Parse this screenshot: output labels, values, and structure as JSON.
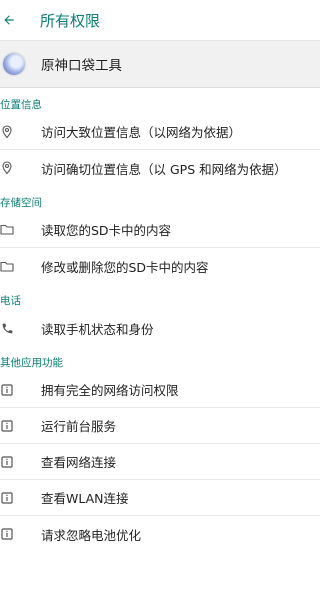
{
  "header": {
    "title": "所有权限",
    "back_icon": "arrow-back-icon"
  },
  "app": {
    "name": "原神口袋工具",
    "icon": "app-icon"
  },
  "sections": [
    {
      "title": "位置信息",
      "items": [
        {
          "label": "访问大致位置信息（以网络为依据）",
          "icon": "location-pin-icon"
        },
        {
          "label": "访问确切位置信息（以 GPS 和网络为依据）",
          "icon": "location-pin-icon"
        }
      ]
    },
    {
      "title": "存储空间",
      "items": [
        {
          "label": "读取您的SD卡中的内容",
          "icon": "folder-icon"
        },
        {
          "label": "修改或删除您的SD卡中的内容",
          "icon": "folder-icon"
        }
      ]
    },
    {
      "title": "电话",
      "items": [
        {
          "label": "读取手机状态和身份",
          "icon": "phone-icon"
        }
      ]
    },
    {
      "title": "其他应用功能",
      "items": [
        {
          "label": "拥有完全的网络访问权限",
          "icon": "info-icon"
        },
        {
          "label": "运行前台服务",
          "icon": "info-icon"
        },
        {
          "label": "查看网络连接",
          "icon": "info-icon"
        },
        {
          "label": "查看WLAN连接",
          "icon": "info-icon"
        },
        {
          "label": "请求忽略电池优化",
          "icon": "info-icon"
        }
      ]
    }
  ],
  "colors": {
    "accent": "#0b7d74",
    "app_row_bg": "#f1f1f1",
    "icon": "#555555"
  }
}
